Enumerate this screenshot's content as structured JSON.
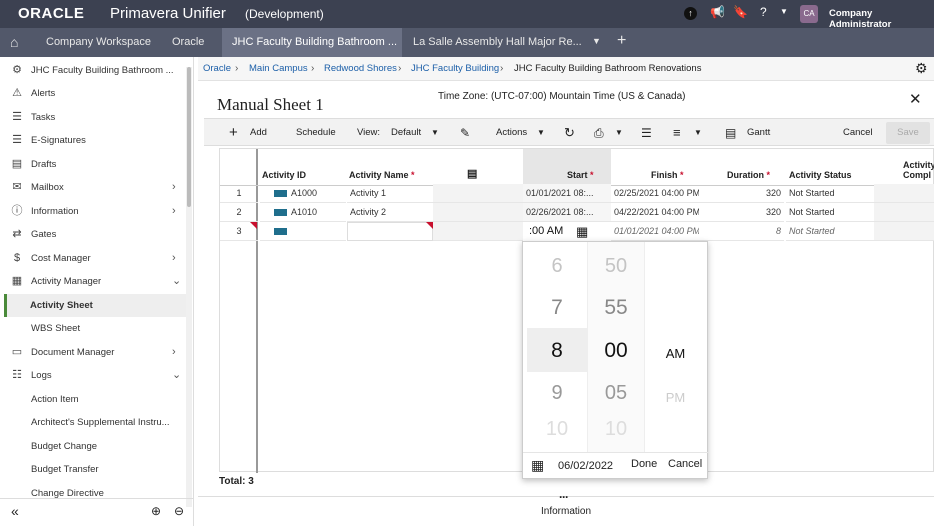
{
  "app": {
    "brand": "ORACLE",
    "product": "Primavera Unifier",
    "env": "(Development)",
    "user_initials": "CA",
    "user_name": "Company Administrator"
  },
  "tabs": [
    "Company Workspace",
    "Oracle",
    "JHC Faculty Building Bathroom ...",
    "La Salle Assembly Hall Major Re..."
  ],
  "sidebar": {
    "project": "JHC Faculty Building Bathroom ...",
    "items": [
      {
        "label": "Alerts",
        "icon": "warning-icon"
      },
      {
        "label": "Tasks",
        "icon": "task-list-icon"
      },
      {
        "label": "E-Signatures",
        "icon": "signature-icon"
      },
      {
        "label": "Drafts",
        "icon": "drafts-icon"
      },
      {
        "label": "Mailbox",
        "icon": "mail-icon"
      },
      {
        "label": "Information",
        "icon": "info-icon"
      },
      {
        "label": "Gates",
        "icon": "gates-icon"
      },
      {
        "label": "Cost Manager",
        "icon": "dollar-icon"
      },
      {
        "label": "Activity Manager",
        "icon": "calendar-icon"
      },
      {
        "label": "Activity Sheet"
      },
      {
        "label": "WBS Sheet"
      },
      {
        "label": "Document Manager",
        "icon": "folder-icon"
      },
      {
        "label": "Logs",
        "icon": "logs-icon"
      },
      {
        "label": "Action Item"
      },
      {
        "label": "Architect's Supplemental Instru..."
      },
      {
        "label": "Budget Change"
      },
      {
        "label": "Budget Transfer"
      },
      {
        "label": "Change Directive"
      }
    ]
  },
  "breadcrumb": [
    "Oracle",
    "Main Campus",
    "Redwood Shores",
    "JHC Faculty Building",
    "JHC Faculty Building Bathroom Renovations"
  ],
  "sheet": {
    "title": "Manual Sheet 1",
    "timezone": "Time Zone: (UTC-07:00) Mountain Time (US & Canada)"
  },
  "toolbar": {
    "add": "Add",
    "schedule": "Schedule",
    "view_label": "View:",
    "view_value": "Default",
    "actions": "Actions",
    "gantt": "Gantt",
    "cancel": "Cancel",
    "save": "Save"
  },
  "columns": {
    "activity_id": "Activity ID",
    "activity_name": "Activity Name",
    "start": "Start",
    "finish": "Finish",
    "duration": "Duration",
    "status": "Activity Status",
    "completion_1": "Activity",
    "completion_2": "Compl"
  },
  "rows": [
    {
      "num": "1",
      "id": "A1000",
      "name": "Activity 1",
      "start": "01/01/2021 08:...",
      "finish": "02/25/2021 04:00 PM",
      "duration": "320",
      "status": "Not Started"
    },
    {
      "num": "2",
      "id": "A1010",
      "name": "Activity 2",
      "start": "02/26/2021 08:...",
      "finish": "04/22/2021 04:00 PM",
      "duration": "320",
      "status": "Not Started"
    },
    {
      "num": "3",
      "id": "",
      "name": "",
      "start": ":00 AM",
      "finish": "01/01/2021 04:00 PM",
      "duration": "8",
      "status": "Not Started"
    }
  ],
  "picker": {
    "hours": [
      "6",
      "7",
      "8",
      "9",
      "10"
    ],
    "minutes": [
      "50",
      "55",
      "00",
      "05",
      "10"
    ],
    "ampm": [
      "AM",
      "PM"
    ],
    "date": "06/02/2022",
    "done": "Done",
    "cancel": "Cancel"
  },
  "total": "Total: 3",
  "footer_info": "Information"
}
